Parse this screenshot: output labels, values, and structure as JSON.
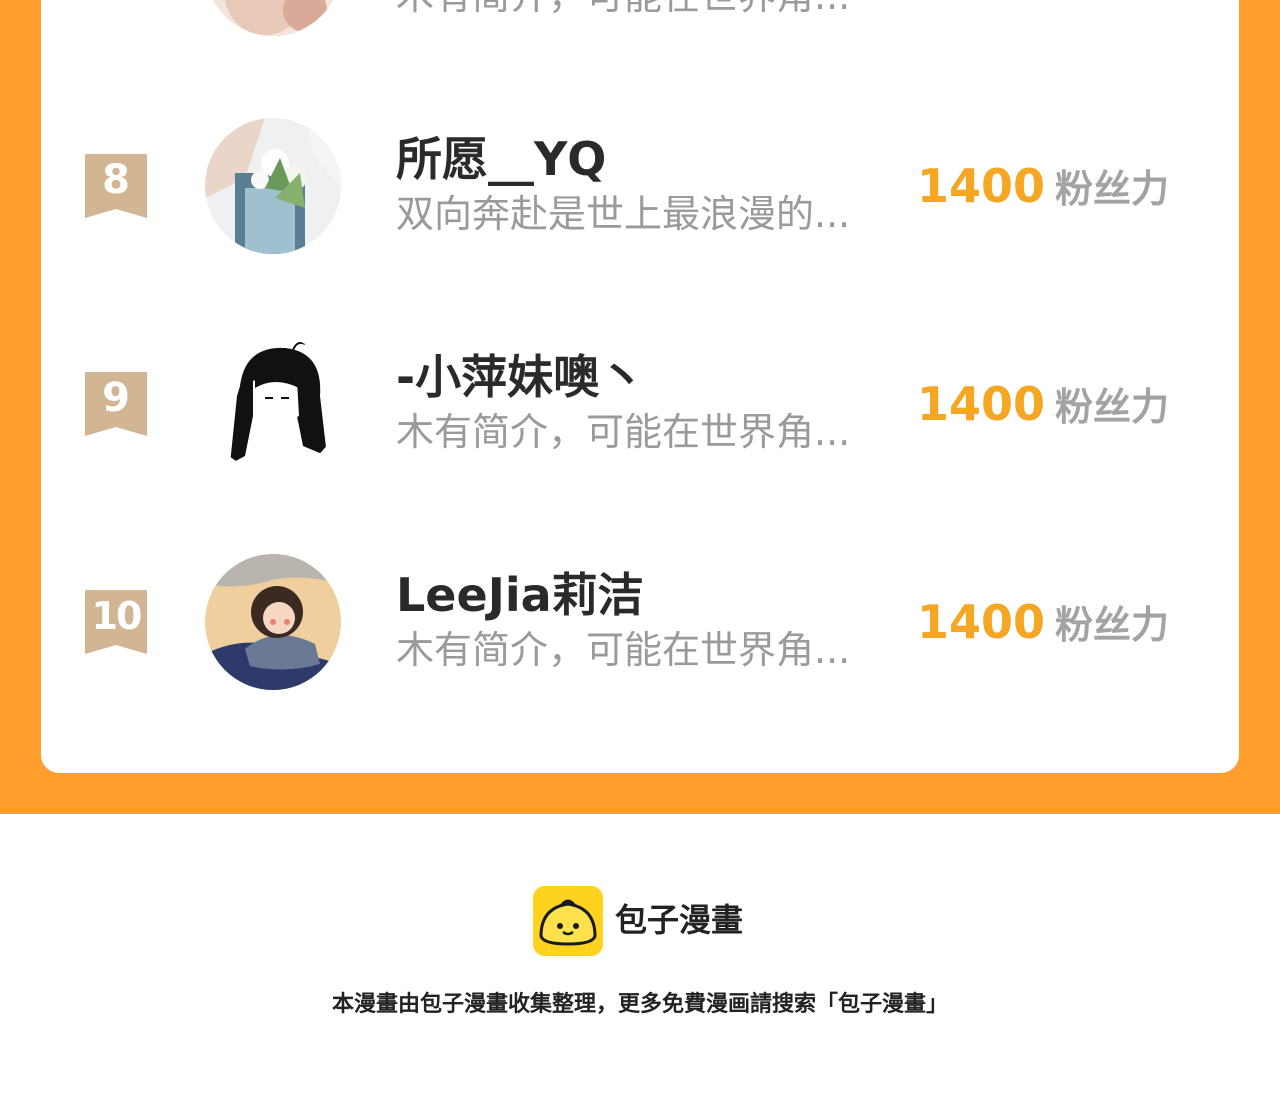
{
  "colors": {
    "band": "#ff9e2c",
    "card": "#ffffff",
    "rank_badge": "#d2b694",
    "fans_number": "#f5a623",
    "fans_label": "#a3a3a3",
    "name": "#2a2a2a",
    "bio": "#9a9a9a",
    "logo_bg": "#ffd21f"
  },
  "list": {
    "partial_row": {
      "bio": "木有简介，可能在世界角..."
    },
    "rows": [
      {
        "rank": "8",
        "name": "所愿__YQ",
        "bio": "双向奔赴是世上最浪漫的...",
        "fans_value": "1400",
        "fans_label": "粉丝力",
        "avatar_icon": "flowers-photo-avatar"
      },
      {
        "rank": "9",
        "name": "-小萍妹噢丶",
        "bio": "木有简介，可能在世界角...",
        "fans_value": "1400",
        "fans_label": "粉丝力",
        "avatar_icon": "girl-sketch-avatar"
      },
      {
        "rank": "10",
        "name": "LeeJia莉洁",
        "bio": "木有简介，可能在世界角...",
        "fans_value": "1400",
        "fans_label": "粉丝力",
        "avatar_icon": "cartoon-girl-avatar"
      }
    ]
  },
  "footer": {
    "logo_icon": "bun-logo-icon",
    "brand": "包子漫畫",
    "note": "本漫畫由包子漫畫收集整理，更多免費漫画請搜索「包子漫畫」"
  }
}
